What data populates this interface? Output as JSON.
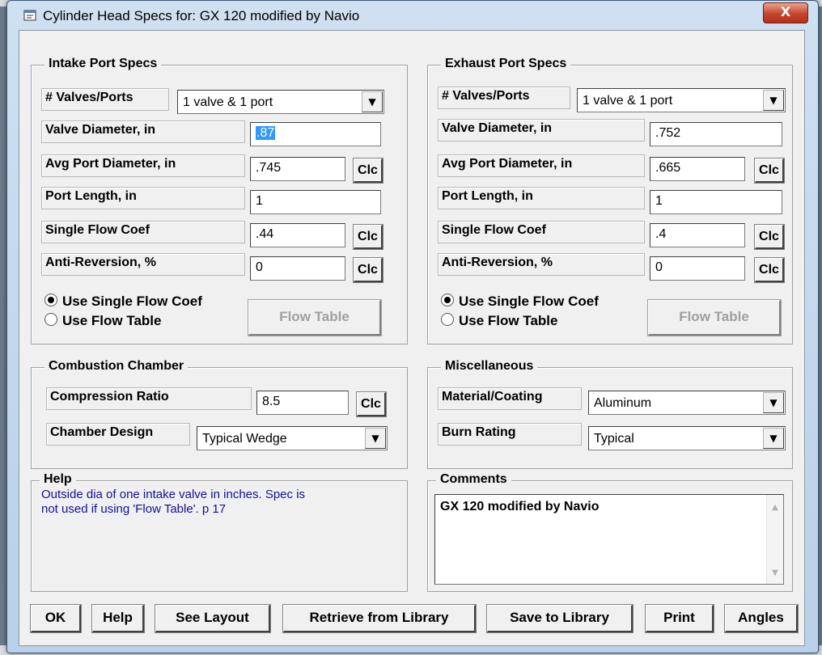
{
  "window": {
    "title": "Cylinder Head Specs for:  GX 120 modified by Navio",
    "close_label": "X"
  },
  "intake": {
    "legend": "Intake Port Specs",
    "valves_label": "# Valves/Ports",
    "valves_value": "1 valve & 1 port",
    "valve_diameter_label": "Valve Diameter, in",
    "valve_diameter_value": ".87",
    "port_diameter_label": "Avg Port Diameter, in",
    "port_diameter_value": ".745",
    "port_length_label": "Port Length, in",
    "port_length_value": "1",
    "flow_coef_label": "Single Flow Coef",
    "flow_coef_value": ".44",
    "anti_rev_label": "Anti-Reversion, %",
    "anti_rev_value": "0",
    "radio_single": "Use Single Flow Coef",
    "radio_table": "Use Flow Table",
    "flow_table_btn": "Flow Table"
  },
  "exhaust": {
    "legend": "Exhaust Port Specs",
    "valves_label": "# Valves/Ports",
    "valves_value": "1 valve & 1 port",
    "valve_diameter_label": "Valve Diameter, in",
    "valve_diameter_value": ".752",
    "port_diameter_label": "Avg Port Diameter, in",
    "port_diameter_value": ".665",
    "port_length_label": "Port Length, in",
    "port_length_value": "1",
    "flow_coef_label": "Single Flow Coef",
    "flow_coef_value": ".4",
    "anti_rev_label": "Anti-Reversion, %",
    "anti_rev_value": "0",
    "radio_single": "Use Single Flow Coef",
    "radio_table": "Use Flow Table",
    "flow_table_btn": "Flow Table"
  },
  "clc_label": "Clc",
  "combustion": {
    "legend": "Combustion Chamber",
    "compression_label": "Compression Ratio",
    "compression_value": "8.5",
    "design_label": "Chamber Design",
    "design_value": "Typical Wedge"
  },
  "misc": {
    "legend": "Miscellaneous",
    "material_label": "Material/Coating",
    "material_value": "Aluminum",
    "burn_label": "Burn Rating",
    "burn_value": "Typical"
  },
  "help": {
    "legend": "Help",
    "line1": "Outside dia of one intake valve in inches.  Spec is",
    "line2": "not used if using 'Flow Table'.     p 17"
  },
  "comments": {
    "legend": "Comments",
    "text": "GX 120 modified by Navio"
  },
  "buttons": {
    "ok": "OK",
    "help": "Help",
    "see_layout": "See Layout",
    "retrieve": "Retrieve from Library",
    "save": "Save to Library",
    "print": "Print",
    "angles": "Angles"
  }
}
